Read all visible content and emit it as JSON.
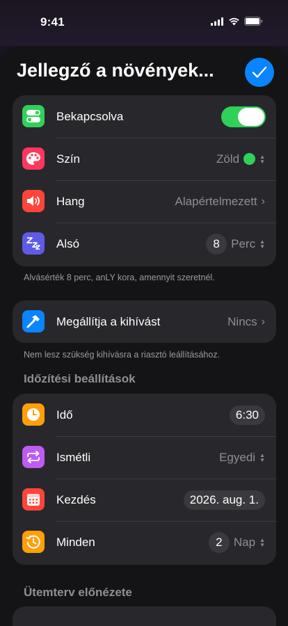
{
  "status": {
    "time": "9:41"
  },
  "header": {
    "title": "Jellegző a növények..."
  },
  "main_group": {
    "rows": [
      {
        "label": "Bekapcsolva",
        "icon": "toggle-icon",
        "color": "#30d158"
      },
      {
        "label": "Szín",
        "value": "Zöld",
        "icon": "palette-icon",
        "color": "#ff375f"
      },
      {
        "label": "Hang",
        "value": "Alapértelmezett",
        "icon": "speaker-icon",
        "color": "#ff453a"
      },
      {
        "label": "Alsó",
        "number": "8",
        "unit": "Perc",
        "icon": "sleep-icon",
        "color": "#5e5ce6"
      }
    ],
    "footnote": "Alvásérték 8 perc, anLY kora, amennyit szeretnél."
  },
  "challenge_group": {
    "label": "Megállítja a kihívást",
    "value": "Nincs",
    "icon": "hammer-icon",
    "color": "#0a84ff",
    "footnote": "Nem lesz szükség kihívásra a riasztó leállításához."
  },
  "timing": {
    "header": "Időzítési beállítások",
    "rows": [
      {
        "label": "Idő",
        "value": "6:30",
        "icon": "clock-icon",
        "color": "#ff9f0a"
      },
      {
        "label": "Ismétli",
        "value": "Egyedi",
        "icon": "repeat-icon",
        "color": "#bf5af2"
      },
      {
        "label": "Kezdés",
        "value": "2026. aug. 1.",
        "icon": "calendar-icon",
        "color": "#ff453a"
      },
      {
        "label": "Minden",
        "number": "2",
        "unit": "Nap",
        "icon": "history-icon",
        "color": "#ff9f0a"
      }
    ]
  },
  "preview": {
    "header": "Ütemterv előnézete"
  }
}
